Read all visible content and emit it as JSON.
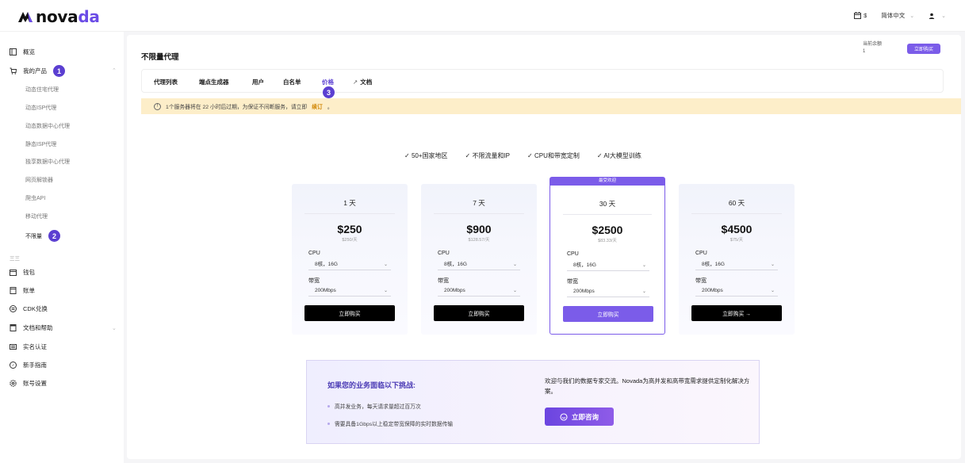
{
  "header": {
    "logo_prefix": "nova",
    "logo_accent": "da",
    "calendar_text": "$",
    "language": "简体中文",
    "colors": {
      "brand": "#6b4ce6",
      "accent": "#7b5ce9",
      "warning_bg": "#fdeec9",
      "renew": "#d08400"
    }
  },
  "sidebar": {
    "overview": "概览",
    "my_products": "我的产品",
    "badge_1": "1",
    "sub_items": [
      "动态住宅代理",
      "动态ISP代理",
      "动态数据中心代理",
      "静态ISP代理",
      "独享数据中心代理",
      "网页解锁器",
      "爬虫API",
      "移动代理",
      "不限量"
    ],
    "badge_2": "2",
    "section_label": "三三",
    "items": [
      "钱包",
      "账单",
      "CDK兑换",
      "文档和帮助",
      "实名认证",
      "新手指南",
      "账号设置"
    ]
  },
  "main": {
    "title": "不限量代理",
    "balance_label": "当前余额",
    "balance_value": "1",
    "buy_top": "立即购买",
    "tabs": [
      "代理列表",
      "端点生成器",
      "用户",
      "白名单",
      "价格",
      "文档"
    ],
    "tab_badge": "3",
    "notice_prefix": "1个服务器将在 22 小时后过期，为保证不间断服务，请立即",
    "notice_link": "续订",
    "notice_suffix": "。",
    "features": [
      "50+国家地区",
      "不限流量和IP",
      "CPU和带宽定制",
      "AI大模型训练"
    ],
    "plans": [
      {
        "duration": "1 天",
        "price": "$250",
        "per": "$250/天",
        "cpu_label": "CPU",
        "cpu_value": "8核，16G",
        "bw_label": "带宽",
        "bw_value": "200Mbps",
        "buy": "立即购买",
        "popular": false
      },
      {
        "duration": "7 天",
        "price": "$900",
        "per": "$128.57/天",
        "cpu_label": "CPU",
        "cpu_value": "8核，16G",
        "bw_label": "带宽",
        "bw_value": "200Mbps",
        "buy": "立即购买",
        "popular": false
      },
      {
        "duration": "30 天",
        "price": "$2500",
        "per": "$83.33/天",
        "cpu_label": "CPU",
        "cpu_value": "8核，16G",
        "bw_label": "带宽",
        "bw_value": "200Mbps",
        "buy": "立即购买",
        "popular": true,
        "ribbon": "最受欢迎"
      },
      {
        "duration": "60 天",
        "price": "$4500",
        "per": "$75/天",
        "cpu_label": "CPU",
        "cpu_value": "8核，16G",
        "bw_label": "带宽",
        "bw_value": "200Mbps",
        "buy": "立即购买 →",
        "popular": false
      }
    ],
    "consult": {
      "heading": "如果您的业务面临以下挑战:",
      "bullets": [
        "高并发业务，每天请求量超过百万次",
        "需要具备1Gbps以上稳定带宽保障的实时数据传输"
      ],
      "desc": "欢迎与我们的数据专家交流。Novada为高并发和高带宽需求提供定制化解决方案。",
      "button": "立即咨询"
    }
  }
}
